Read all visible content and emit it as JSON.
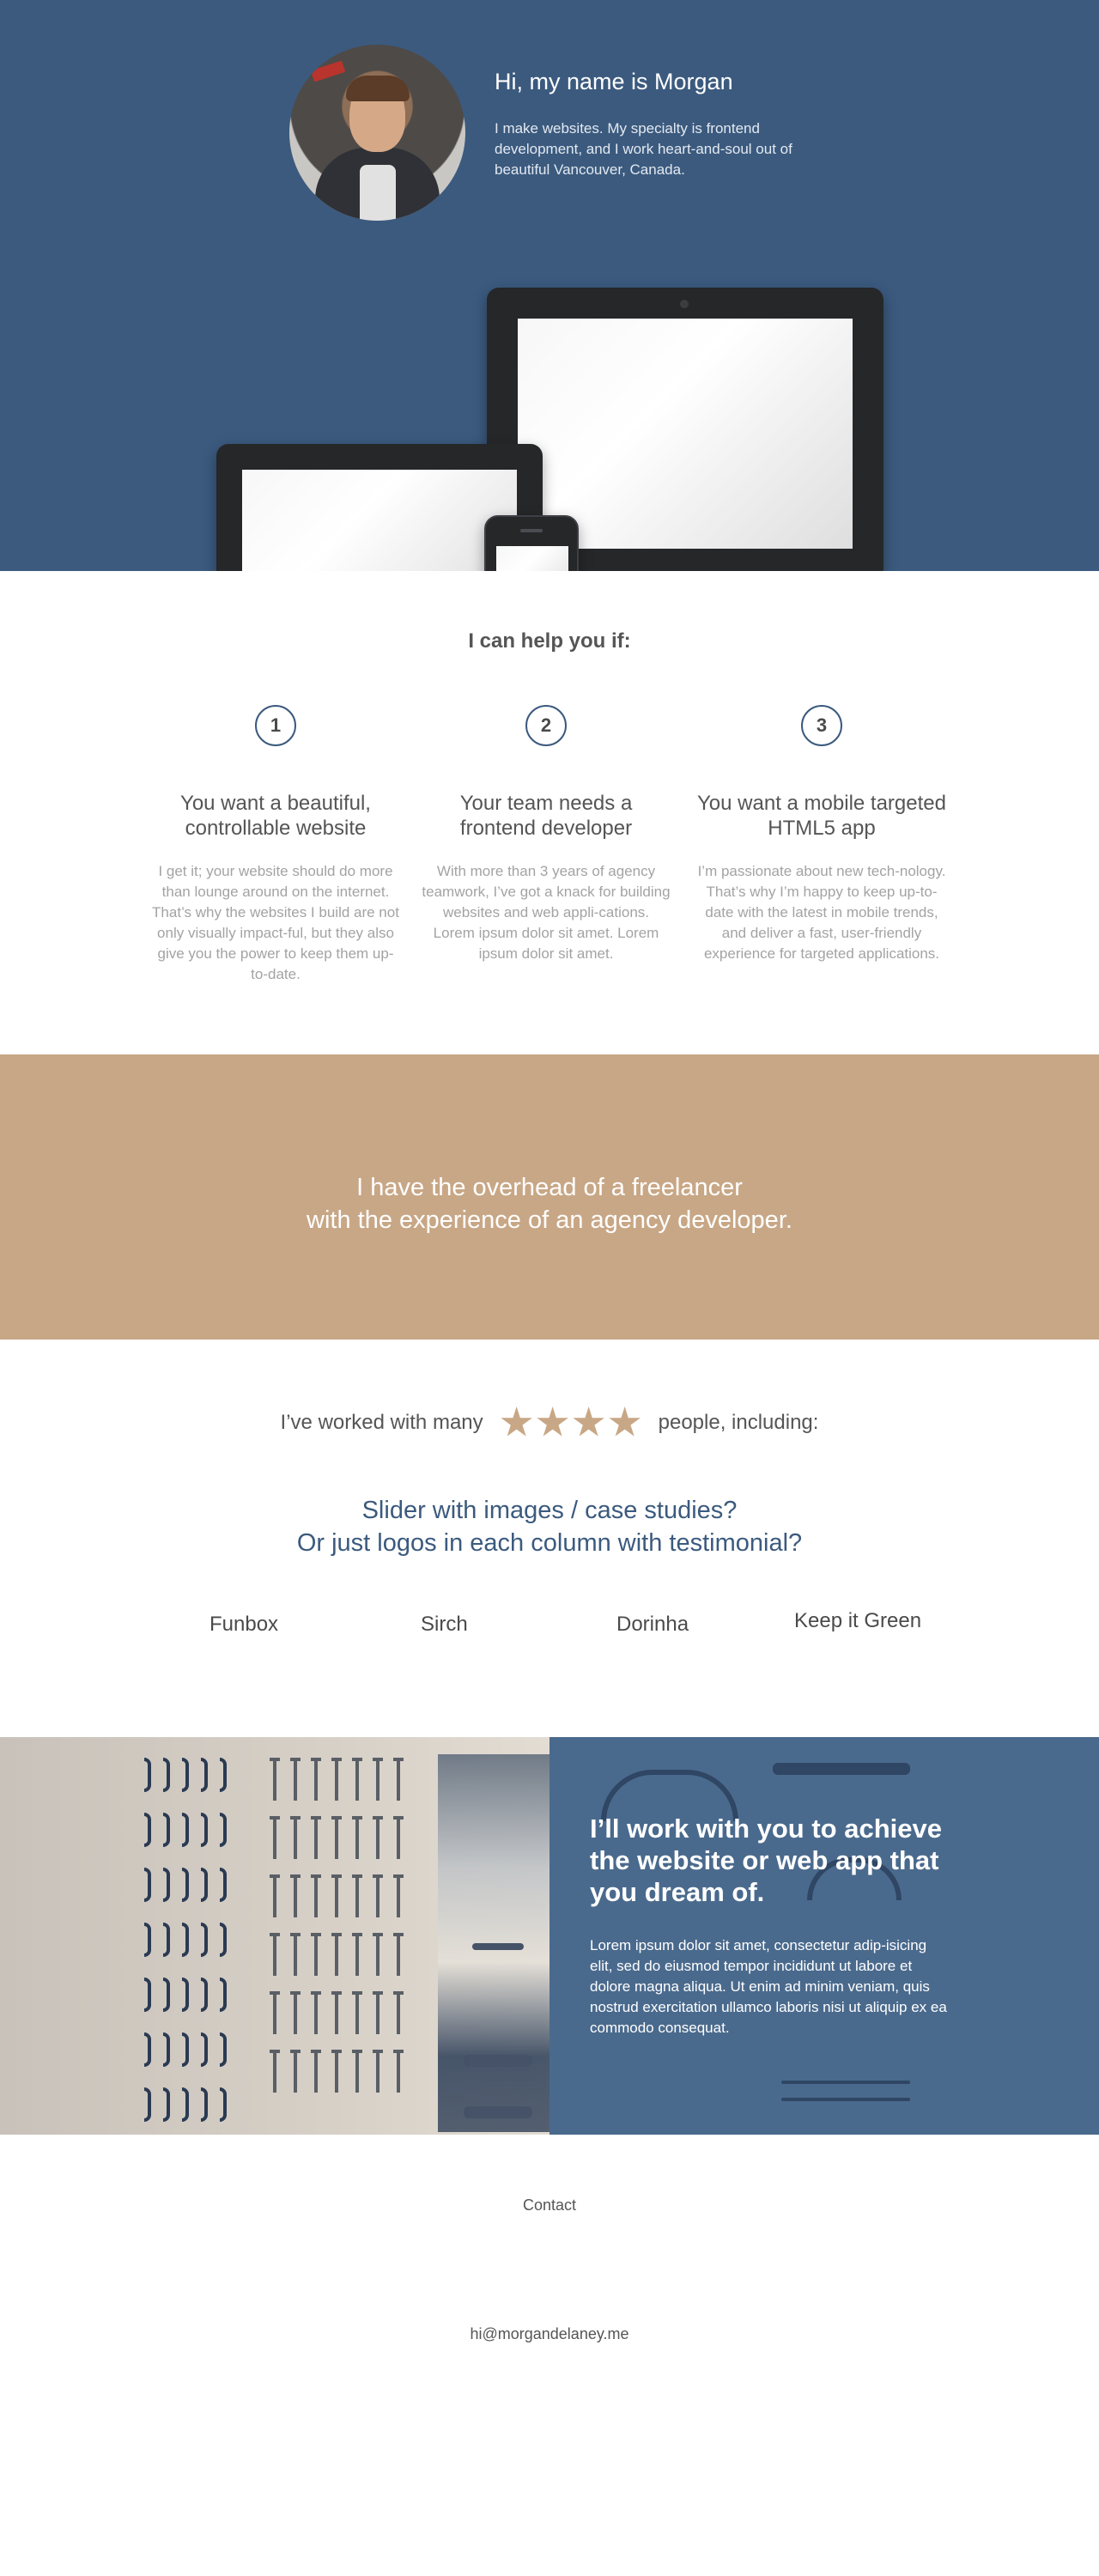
{
  "hero": {
    "title": "Hi, my name is Morgan",
    "text": "I make websites. My specialty is frontend development, and I work heart-and-soul out of beautiful Vancouver, Canada.",
    "background_color": "#3b5a7e"
  },
  "help": {
    "heading": "I can help you if:",
    "columns": [
      {
        "number": "1",
        "title": "You want a beautiful, controllable website",
        "text": "I get it; your website should do more than lounge around on the internet. That’s why the websites I build are not only visually impact-ful, but they also give you the power to keep them up-to-date."
      },
      {
        "number": "2",
        "title": "Your team needs a frontend developer",
        "text": "With more than 3 years of agency teamwork, I’ve got a knack for building websites and web appli-cations. Lorem ipsum dolor sit amet. Lorem ipsum dolor sit amet."
      },
      {
        "number": "3",
        "title": "You want a mobile targeted HTML5 app",
        "text": "I’m passionate about new tech-nology. That’s why I’m happy to keep up-to-date with the latest in mobile trends, and deliver a fast, user-friendly experience for targeted applications."
      }
    ]
  },
  "band": {
    "line1": "I have the overhead of a freelancer",
    "line2": "with the experience of an agency developer.",
    "background_color": "#c8a786"
  },
  "worked": {
    "prefix": "I’ve worked with many",
    "suffix": "people, including:",
    "stars": 4,
    "slider_line1": "Slider with images / case studies?",
    "slider_line2": "Or just logos in each column with testimonial?",
    "clients": [
      "Funbox",
      "Sirch",
      "Dorinha",
      "Keep it Green"
    ]
  },
  "work": {
    "title": "I’ll work with you to achieve the website or web app that you dream of.",
    "text": "Lorem ipsum dolor sit amet, consectetur adip-isicing elit, sed do eiusmod tempor incididunt ut labore et dolore magna aliqua. Ut enim ad minim veniam, quis nostrud exercitation ullamco laboris nisi ut aliquip ex ea commodo consequat.",
    "overlay_color": "#4a6a8d"
  },
  "contact": {
    "link": "Contact",
    "email": "hi@morgandelaney.me"
  }
}
